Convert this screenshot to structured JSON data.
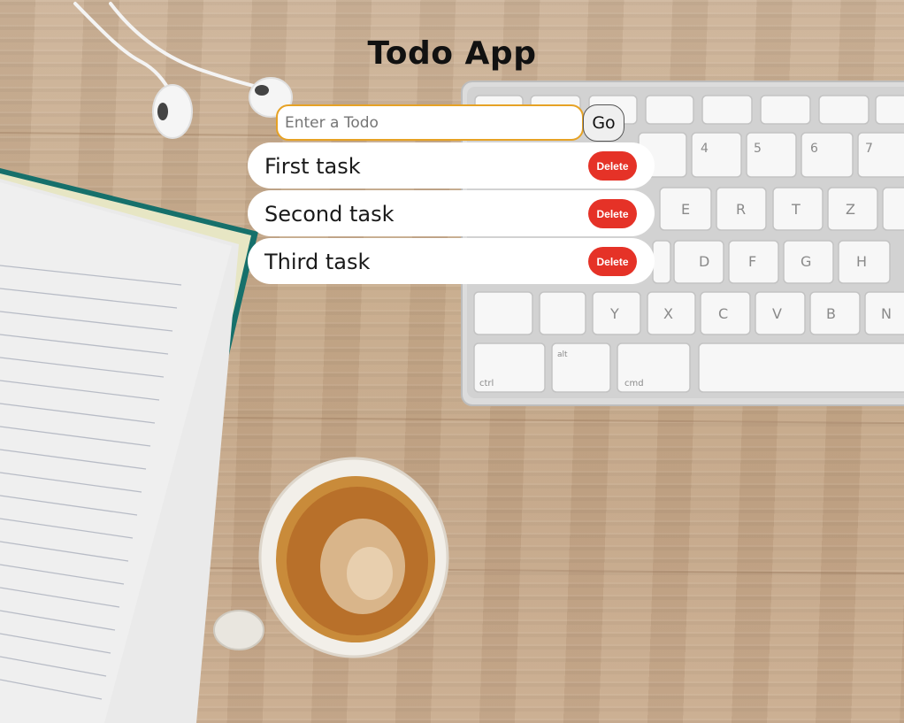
{
  "app": {
    "title": "Todo App"
  },
  "form": {
    "placeholder": "Enter a Todo",
    "value": "",
    "go_label": "Go"
  },
  "todos": [
    {
      "text": "First task",
      "delete_label": "Delete"
    },
    {
      "text": "Second task",
      "delete_label": "Delete"
    },
    {
      "text": "Third task",
      "delete_label": "Delete"
    }
  ],
  "colors": {
    "input_border": "#e6a225",
    "delete_bg": "#e53227",
    "item_bg": "#ffffff"
  }
}
